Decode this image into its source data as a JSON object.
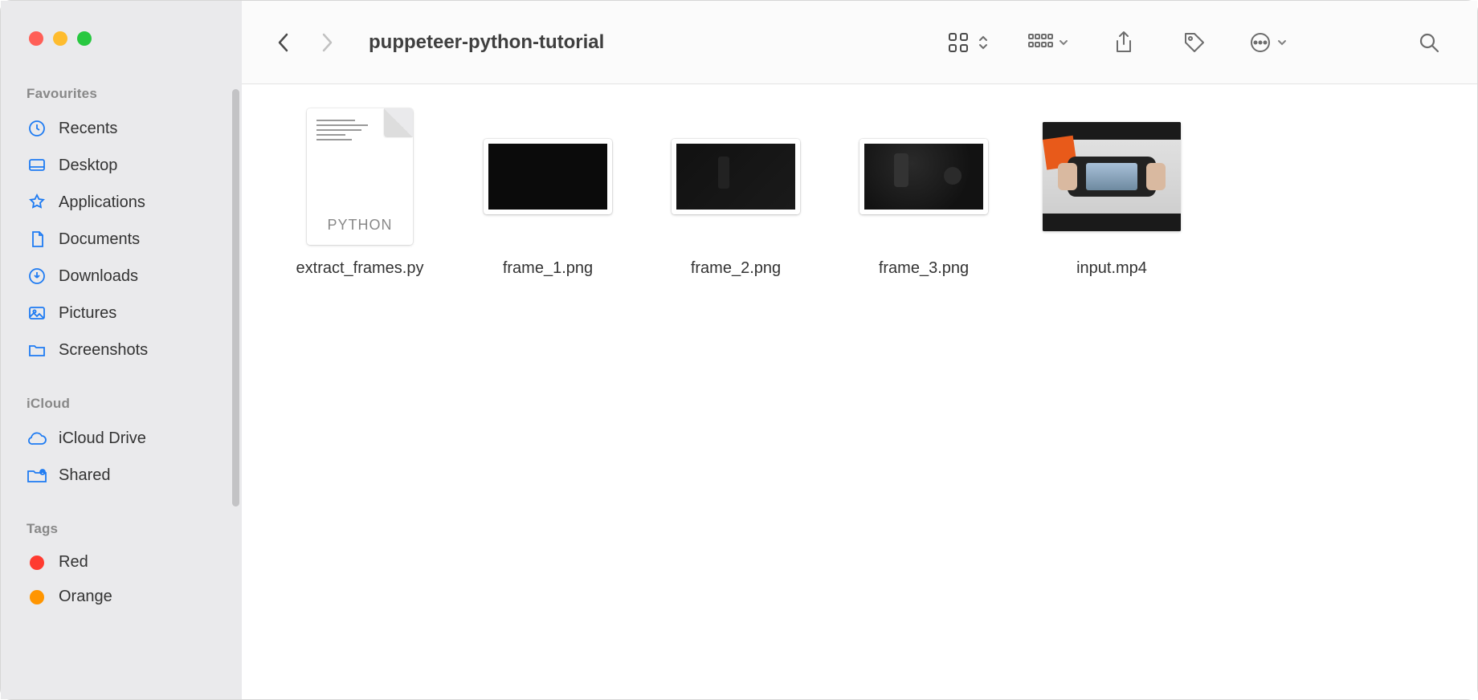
{
  "window": {
    "title": "puppeteer-python-tutorial"
  },
  "sidebar": {
    "sections": {
      "favourites": {
        "header": "Favourites",
        "items": [
          {
            "label": "Recents",
            "icon": "clock-icon"
          },
          {
            "label": "Desktop",
            "icon": "desktop-icon"
          },
          {
            "label": "Applications",
            "icon": "applications-icon"
          },
          {
            "label": "Documents",
            "icon": "document-icon"
          },
          {
            "label": "Downloads",
            "icon": "downloads-icon"
          },
          {
            "label": "Pictures",
            "icon": "pictures-icon"
          },
          {
            "label": "Screenshots",
            "icon": "folder-icon"
          }
        ]
      },
      "icloud": {
        "header": "iCloud",
        "items": [
          {
            "label": "iCloud Drive",
            "icon": "cloud-icon"
          },
          {
            "label": "Shared",
            "icon": "shared-folder-icon"
          }
        ]
      },
      "tags": {
        "header": "Tags",
        "items": [
          {
            "label": "Red",
            "color": "#ff3b30"
          },
          {
            "label": "Orange",
            "color": "#ff9500"
          }
        ]
      }
    }
  },
  "files": [
    {
      "name": "extract_frames.py",
      "type": "python",
      "badge": "PYTHON"
    },
    {
      "name": "frame_1.png",
      "type": "image"
    },
    {
      "name": "frame_2.png",
      "type": "image"
    },
    {
      "name": "frame_3.png",
      "type": "image"
    },
    {
      "name": "input.mp4",
      "type": "video"
    }
  ]
}
